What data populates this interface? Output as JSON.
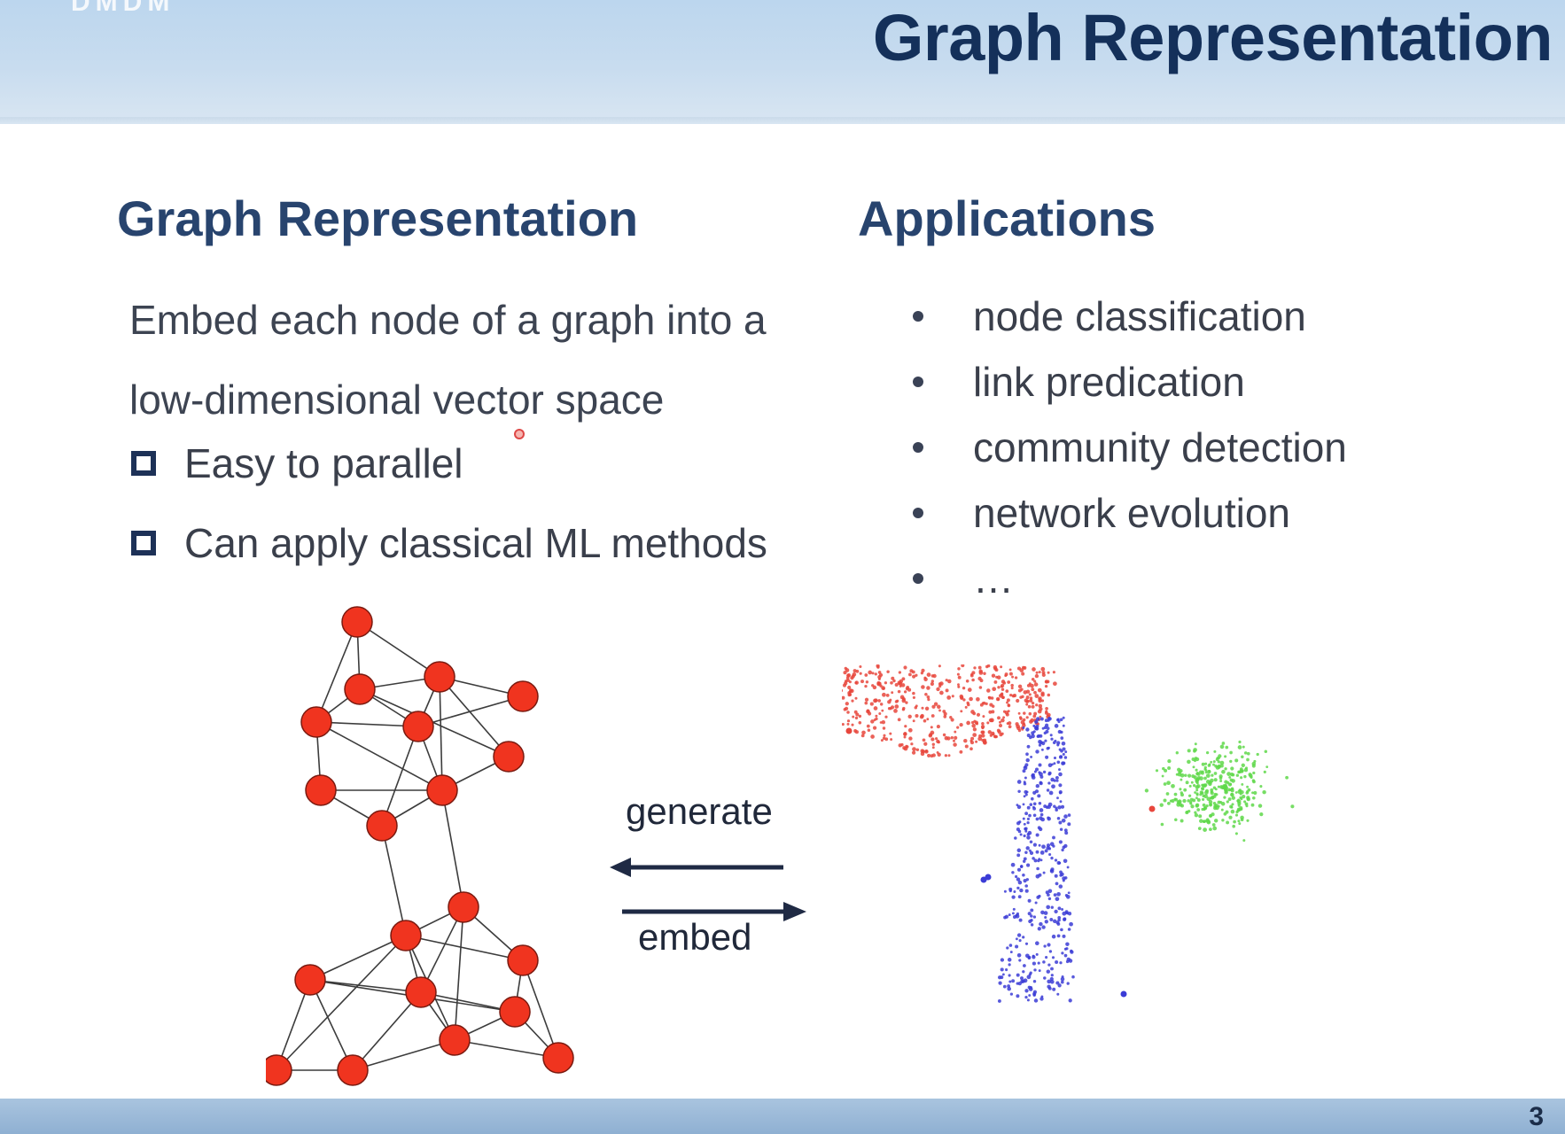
{
  "header": {
    "title": "Graph Representation",
    "logo_text": "DMDM"
  },
  "left": {
    "heading": "Graph Representation",
    "description_line1": "Embed each node of a graph into a",
    "description_line2": "low-dimensional vector space",
    "checklist": [
      {
        "label": "Easy to parallel"
      },
      {
        "label": "Can apply classical ML methods"
      }
    ]
  },
  "right": {
    "heading": "Applications",
    "items": [
      {
        "label": "node classification"
      },
      {
        "label": "link predication"
      },
      {
        "label": "community detection"
      },
      {
        "label": "network evolution"
      },
      {
        "label": "…"
      }
    ]
  },
  "arrows": {
    "generate_label": "generate",
    "embed_label": "embed"
  },
  "footer": {
    "page_number": "3"
  },
  "colors": {
    "title": "#14305a",
    "heading": "#28446e",
    "node_fill": "#f0341f",
    "cluster_red": "#e8463c",
    "cluster_blue": "#3b3cd6",
    "cluster_green": "#5fd84a"
  }
}
